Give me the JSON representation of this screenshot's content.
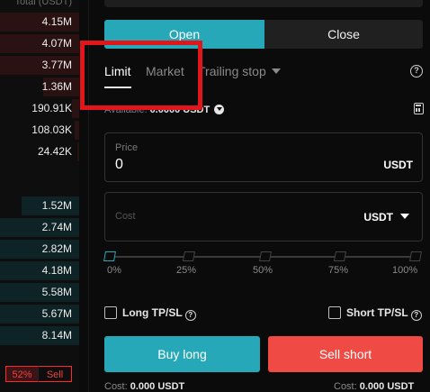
{
  "order_book": {
    "header": "Total (USDT)",
    "asks": [
      "4.15M",
      "4.07M",
      "3.77M",
      "1.36M",
      "190.91K",
      "108.03K",
      "24.42K"
    ],
    "bids": [
      "1.52M",
      "2.74M",
      "2.82M",
      "4.18M",
      "5.58M",
      "5.67M",
      "8.14M"
    ],
    "ratio_percent": "52%",
    "ratio_side": "Sell"
  },
  "trade_panel": {
    "open_label": "Open",
    "close_label": "Close",
    "tabs": {
      "limit": "Limit",
      "market": "Market",
      "trailing": "Trailing stop"
    },
    "available_label": "Available:",
    "available_value": "0.0000 USDT",
    "price": {
      "label": "Price",
      "value": "0",
      "unit": "USDT"
    },
    "cost": {
      "placeholder": "Cost",
      "unit": "USDT"
    },
    "slider": {
      "value_percent": 0,
      "ticks": [
        "0%",
        "25%",
        "50%",
        "75%",
        "100%"
      ]
    },
    "long_tpsl_label": "Long TP/SL",
    "short_tpsl_label": "Short TP/SL",
    "buy_label": "Buy long",
    "sell_label": "Sell short",
    "cost_left_label": "Cost:",
    "cost_left_value": "0.000 USDT",
    "cost_right_label": "Cost:",
    "cost_right_value": "0.000 USDT"
  },
  "colors": {
    "accent": "#27a8b8",
    "sell": "#ef4a44",
    "highlight_box": "#e0161b"
  }
}
